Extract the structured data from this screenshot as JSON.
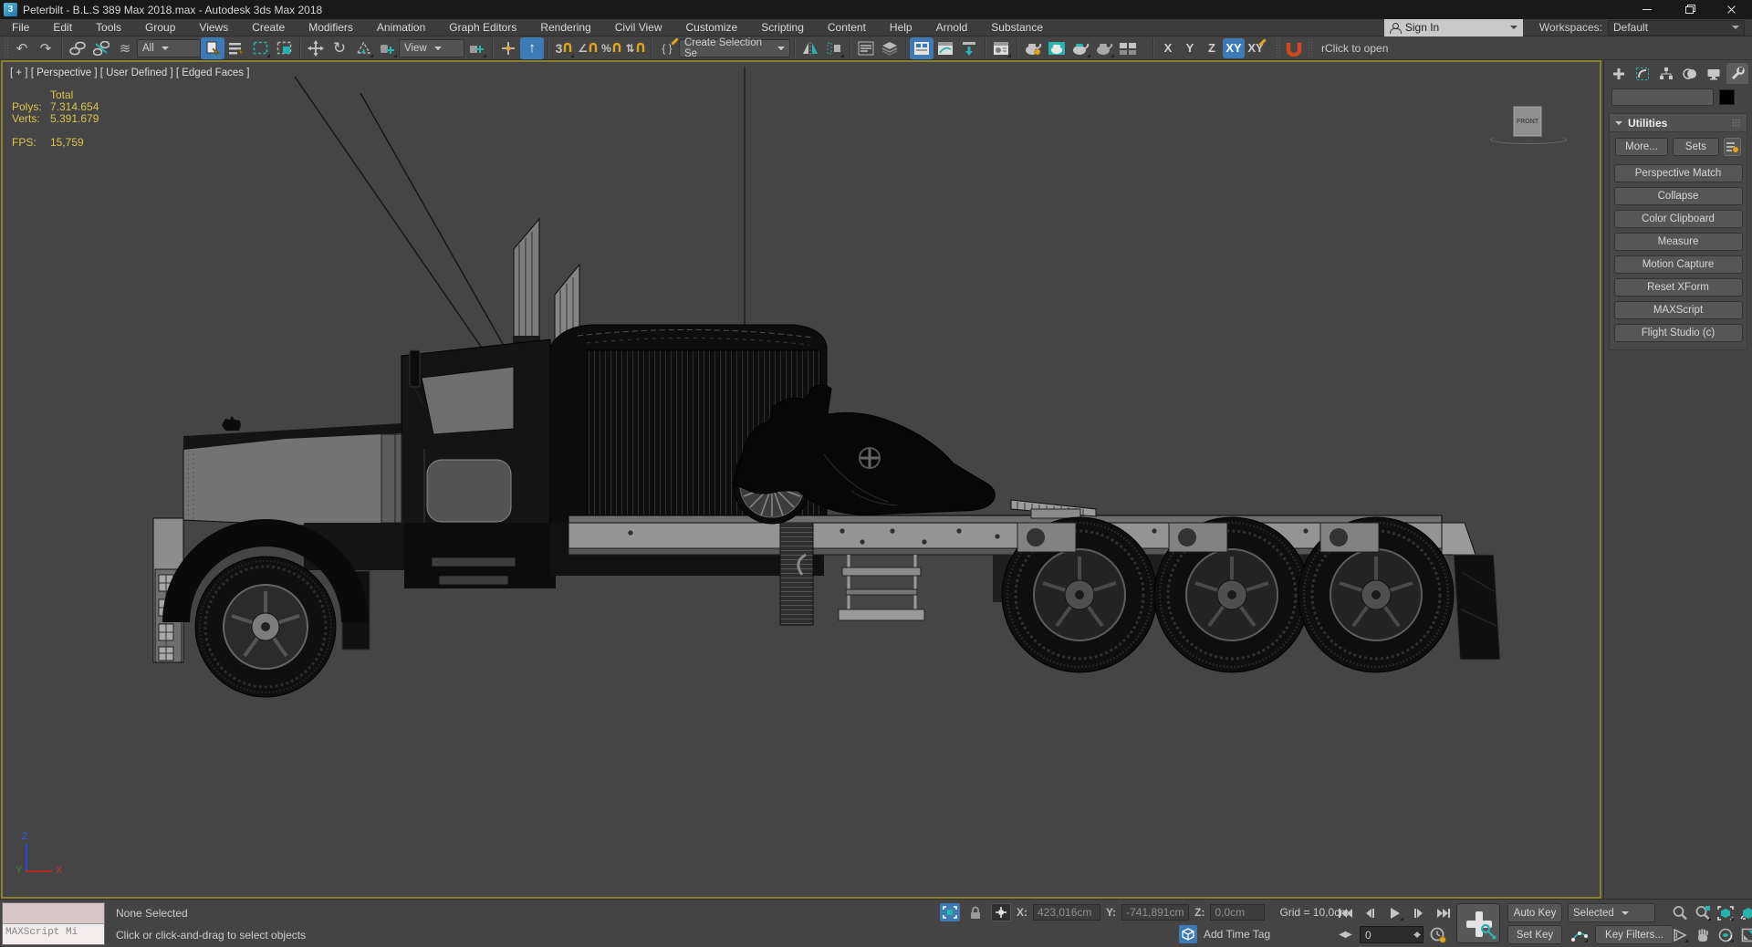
{
  "window": {
    "app_badge": "3",
    "title": "Peterbilt - B.L.S 389 Max 2018.max - Autodesk 3ds Max 2018"
  },
  "menu": {
    "items": [
      "File",
      "Edit",
      "Tools",
      "Group",
      "Views",
      "Create",
      "Modifiers",
      "Animation",
      "Graph Editors",
      "Rendering",
      "Civil View",
      "Customize",
      "Scripting",
      "Content",
      "Help",
      "Arnold",
      "Substance"
    ]
  },
  "account": {
    "sign_in": "Sign In",
    "workspaces_label": "Workspaces:",
    "workspace": "Default"
  },
  "toolbar": {
    "selection_filter": "All",
    "coord_system": "View",
    "named_sets": "Create Selection Se",
    "axis_x": "X",
    "axis_y": "Y",
    "axis_z": "Z",
    "axis_xy": "XY",
    "axis_xy2": "XY",
    "open_hint": "rClick to open",
    "icons": {
      "undo": "↶",
      "redo": "↷",
      "bind": "≋",
      "snap3": "3",
      "angle": "∠",
      "percent": "%",
      "spinner": "⇅",
      "rotate": "↻",
      "braces": "{ }",
      "arrow_up": "↑"
    }
  },
  "viewport": {
    "label": "[ + ] [ Perspective ] [ User Defined ] [ Edged Faces ]",
    "stats": {
      "total": "Total",
      "polys_label": "Polys:",
      "polys": "7.314.654",
      "verts_label": "Verts:",
      "verts": "5.391.679",
      "fps_label": "FPS:",
      "fps": "15,759"
    },
    "viewcube": "FRONT",
    "axis": {
      "x": "X",
      "y": "Y",
      "z": "Z"
    }
  },
  "panel": {
    "rollout": "Utilities",
    "more": "More...",
    "sets": "Sets",
    "utilities": [
      "Perspective Match",
      "Collapse",
      "Color Clipboard",
      "Measure",
      "Motion Capture",
      "Reset XForm",
      "MAXScript",
      "Flight Studio (c)"
    ]
  },
  "statusbar": {
    "listener": "MAXScript Mi",
    "selection": "None Selected",
    "prompt": "Click or click-and-drag to select objects",
    "x_label": "X:",
    "x": "423,016cm",
    "y_label": "Y:",
    "y": "-741,891cm",
    "z_label": "Z:",
    "z": "0,0cm",
    "grid": "Grid = 10,0cm",
    "add_time_tag": "Add Time Tag",
    "auto_key": "Auto Key",
    "set_key": "Set Key",
    "selected": "Selected",
    "key_filters": "Key Filters...",
    "frame": "0",
    "keymode": "◀▶"
  },
  "colors": {
    "accent_blue": "#3e7bb6",
    "accent_teal": "#2ab3ad",
    "accent_yellow": "#e0a422",
    "stats_yellow": "#d8c74e",
    "viewport_border": "#87802f",
    "viewport_bg": "#454545"
  }
}
